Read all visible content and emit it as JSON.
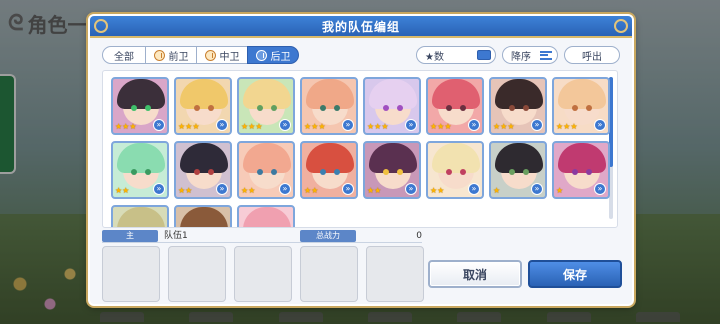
{
  "background": {
    "title": "角色一览"
  },
  "dialog": {
    "title": "我的队伍编组"
  },
  "filters": {
    "all": "全部",
    "front": "前卫",
    "mid": "中卫",
    "back": "后卫",
    "selected": "后卫"
  },
  "sort": {
    "star_label": "★数",
    "order_label": "降序",
    "summon_label": "呼出"
  },
  "roster": {
    "cards": [
      {
        "hair": "#3b2f3a",
        "eye": "#3fbf6a",
        "bg": "#d9a6c8",
        "stars": "★★★"
      },
      {
        "hair": "#f0c86a",
        "eye": "#c07040",
        "bg": "#f2d7b0",
        "stars": "★★★"
      },
      {
        "hair": "#f2d690",
        "eye": "#60a060",
        "bg": "#c9e6b8",
        "stars": "★★★"
      },
      {
        "hair": "#f0a888",
        "eye": "#3b7a6a",
        "bg": "#f5c6b0",
        "stars": "★★★"
      },
      {
        "hair": "#e6d0f0",
        "eye": "#a050c0",
        "bg": "#d8c8ec",
        "stars": "★★★"
      },
      {
        "hair": "#e06070",
        "eye": "#6a3040",
        "bg": "#f2a8a8",
        "stars": "★★★"
      },
      {
        "hair": "#3a2a2a",
        "eye": "#8a4a3a",
        "bg": "#e6c4b8",
        "stars": "★★★"
      },
      {
        "hair": "#f3c79a",
        "eye": "#c07040",
        "bg": "#f7dcc6",
        "stars": "★★★"
      },
      {
        "hair": "#8adcb0",
        "eye": "#3b9a60",
        "bg": "#c6ecd6",
        "stars": "★★"
      },
      {
        "hair": "#2e2a38",
        "eye": "#b04040",
        "bg": "#d0c0d0",
        "stars": "★★"
      },
      {
        "hair": "#f2a890",
        "eye": "#3b7aa0",
        "bg": "#f7cbb8",
        "stars": "★★"
      },
      {
        "hair": "#d85040",
        "eye": "#3b80b0",
        "bg": "#f0b0a0",
        "stars": "★★"
      },
      {
        "hair": "#5a3050",
        "eye": "#f0c040",
        "bg": "#c898b8",
        "stars": "★★"
      },
      {
        "hair": "#f2e2b0",
        "eye": "#c04060",
        "bg": "#f7e6d0",
        "stars": "★★"
      },
      {
        "hair": "#2e2a30",
        "eye": "#6aa060",
        "bg": "#c8d0c8",
        "stars": "★"
      },
      {
        "hair": "#c03a70",
        "eye": "#8a3aa0",
        "bg": "#e0a8c8",
        "stars": "★"
      },
      {
        "hair": "#c8c088",
        "eye": "#607040",
        "bg": "#d8dcb8",
        "stars": ""
      },
      {
        "hair": "#8a5a3a",
        "eye": "#604030",
        "bg": "#d8c0a8",
        "stars": ""
      },
      {
        "hair": "#f0a0b0",
        "eye": "#c06080",
        "bg": "#f7ccd6",
        "stars": ""
      }
    ]
  },
  "team": {
    "tag_label": "主",
    "name": "队伍1",
    "power_label": "总战力",
    "power_value": "0"
  },
  "buttons": {
    "cancel": "取消",
    "save": "保存"
  },
  "colors": {
    "header": "#2a62b5",
    "accent": "#3d78d0",
    "gold": "#c9a860"
  }
}
